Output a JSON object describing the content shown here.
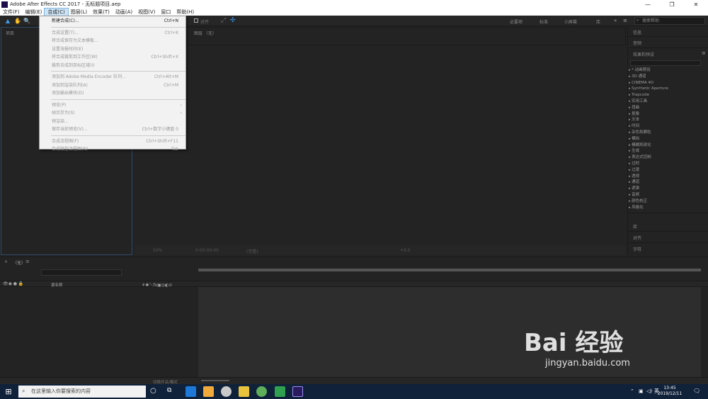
{
  "window": {
    "title": "Adobe After Effects CC 2017 - 无标题项目.aep",
    "minimize": "—",
    "maximize": "❐",
    "close": "✕"
  },
  "menubar": [
    "文件(F)",
    "编辑(E)",
    "合成(C)",
    "图层(L)",
    "效果(T)",
    "动画(A)",
    "视图(V)",
    "窗口",
    "帮助(H)"
  ],
  "toolbar": {
    "align_label": "对齐",
    "workspaces": [
      "必要项",
      "标准",
      "小屏幕",
      "库"
    ],
    "help_placeholder": "搜索帮助"
  },
  "project_panel": {
    "label": "项目"
  },
  "comp_panel": {
    "label": "图层 （无）",
    "zoom": "50%",
    "time": "0:00:00:00",
    "res": "(完整)",
    "exposure": "+0.0"
  },
  "right_panel": {
    "info": "信息",
    "audio": "音频",
    "effects_title": "效果和预设",
    "library": "库",
    "align": "对齐",
    "character": "字符"
  },
  "effects_list": [
    "* 动画预设",
    "3D 通道",
    "CINEMA 4D",
    "Synthetic Aperture",
    "Trapcode",
    "实用工具",
    "扭曲",
    "抠像",
    "文本",
    "时间",
    "杂色和颗粒",
    "模拟",
    "模糊和锐化",
    "生成",
    "表达式控制",
    "过时",
    "过渡",
    "透视",
    "通道",
    "遮罩",
    "音频",
    "颜色校正",
    "风格化"
  ],
  "timeline": {
    "tab": "（无）",
    "source_col": "源名称",
    "footer_label": "切换开关/模式"
  },
  "compose_menu": [
    {
      "label": "新建合成(C)...",
      "shortcut": "Ctrl+N",
      "enabled": true
    },
    {
      "sep": true
    },
    {
      "label": "合成设置(T)...",
      "shortcut": "Ctrl+K",
      "enabled": false
    },
    {
      "label": "将合成保存为文本模板...",
      "shortcut": "",
      "enabled": false
    },
    {
      "label": "设置海报时间(E)",
      "shortcut": "",
      "enabled": false
    },
    {
      "label": "将合成裁剪到工作区(W)",
      "shortcut": "Ctrl+Shift+X",
      "enabled": false
    },
    {
      "label": "裁剪合成到目标区域(I)",
      "shortcut": "",
      "enabled": false
    },
    {
      "sep": true
    },
    {
      "label": "添加到 Adobe Media Encoder 队列...",
      "shortcut": "Ctrl+Alt+M",
      "enabled": false
    },
    {
      "label": "添加到渲染队列(A)",
      "shortcut": "Ctrl+M",
      "enabled": false
    },
    {
      "label": "添加输出模块(D)",
      "shortcut": "",
      "enabled": false
    },
    {
      "sep": true
    },
    {
      "label": "预览(P)",
      "shortcut": "",
      "enabled": false,
      "submenu": true
    },
    {
      "label": "帧另存为(S)",
      "shortcut": "",
      "enabled": false,
      "submenu": true
    },
    {
      "label": "预渲染...",
      "shortcut": "",
      "enabled": false
    },
    {
      "label": "保存当前预览(V)...",
      "shortcut": "Ctrl+数字小键盘 0",
      "enabled": false
    },
    {
      "sep": true
    },
    {
      "label": "合成流程图(F)",
      "shortcut": "Ctrl+Shift+F11",
      "enabled": false
    },
    {
      "label": "合成微型流程图(N)",
      "shortcut": "Tab",
      "enabled": false
    }
  ],
  "taskbar": {
    "search_placeholder": "在这里输入你要搜索的内容",
    "ime": "英",
    "time": "13:45",
    "date": "2019/12/11"
  },
  "watermark": {
    "brand": "Bai 经验",
    "url": "jingyan.baidu.com"
  }
}
